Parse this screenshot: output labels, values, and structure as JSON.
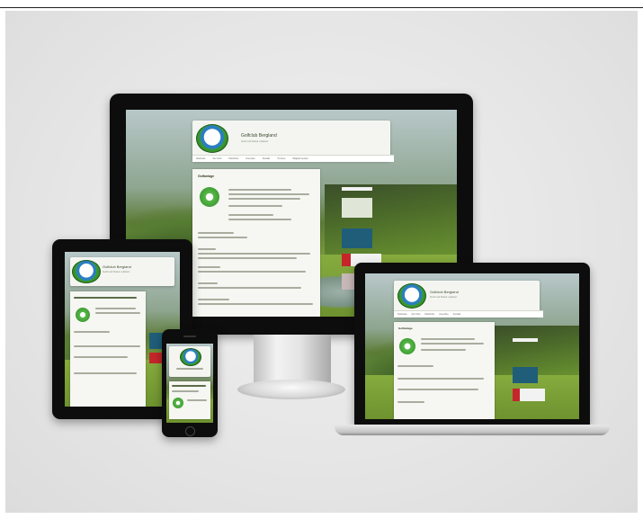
{
  "scene": {
    "background_color": "#e5e5e5",
    "accent_green": "#3f9e34",
    "logo_blue": "#2a7fc0"
  },
  "website": {
    "site_name": "Golfclub Bergland",
    "site_tagline": "Golf und Natur erleben",
    "nav_items": [
      "Startseite",
      "Der Club",
      "Platzinfos",
      "Greenfee",
      "Kontakt",
      "Turniere",
      "Mitglied werden"
    ],
    "card_title": "Golfanlage",
    "badge_icon": "golf-badge-icon",
    "logo_icon": "golf-club-logo-icon"
  },
  "devices": [
    {
      "name": "desktop-monitor",
      "icon": "monitor-icon"
    },
    {
      "name": "tablet",
      "icon": "tablet-icon"
    },
    {
      "name": "smartphone",
      "icon": "smartphone-icon"
    },
    {
      "name": "laptop",
      "icon": "laptop-icon"
    }
  ]
}
